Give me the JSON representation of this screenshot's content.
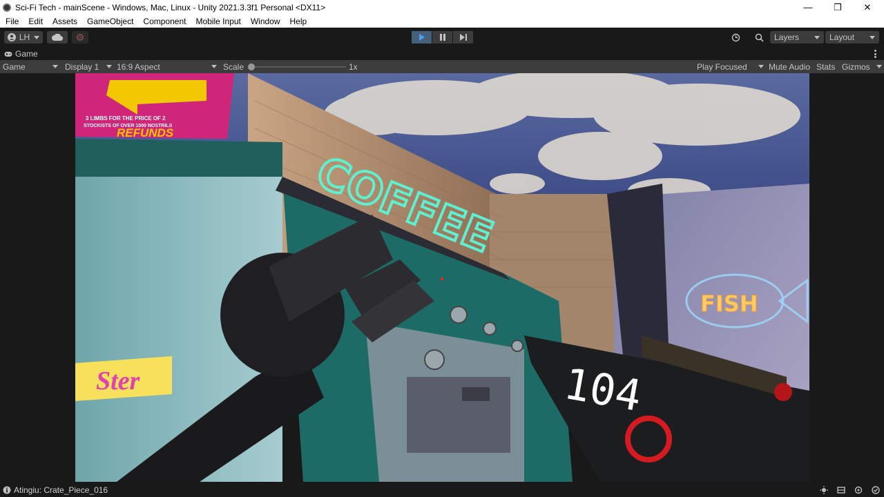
{
  "window": {
    "title": "Sci-Fi Tech - mainScene - Windows, Mac, Linux - Unity 2021.3.3f1 Personal <DX11>",
    "controls": {
      "minimize": "—",
      "restore": "❐",
      "close": "✕"
    }
  },
  "menu": [
    "File",
    "Edit",
    "Assets",
    "GameObject",
    "Component",
    "Mobile Input",
    "Window",
    "Help"
  ],
  "toolbar": {
    "account_label": "LH",
    "layers_label": "Layers",
    "layout_label": "Layout"
  },
  "tab": {
    "label": "Game"
  },
  "gamebar": {
    "mode": "Game",
    "display": "Display 1",
    "aspect": "16:9 Aspect",
    "scale_label": "Scale",
    "scale_value": "1x",
    "scale_fraction": 0.0,
    "play_focused": "Play Focused",
    "mute_audio": "Mute Audio",
    "stats": "Stats",
    "gizmos": "Gizmos"
  },
  "scene": {
    "sign_coffee": "COFFEE",
    "sign_fish": "FISH",
    "banner_line1": "3 LIMBS FOR THE PRICE OF 2",
    "banner_line2": "STOCKISTS OF OVER 1000 NOSTRILS",
    "banner_line3": "REFUNDS",
    "poster_text": "Ster",
    "ammo_count": "104"
  },
  "status": {
    "text": "Atingiu: Crate_Piece_016"
  },
  "colors": {
    "accent_play": "#46607c",
    "editor_bg": "#191919",
    "panel_bg": "#3c3c3c"
  }
}
